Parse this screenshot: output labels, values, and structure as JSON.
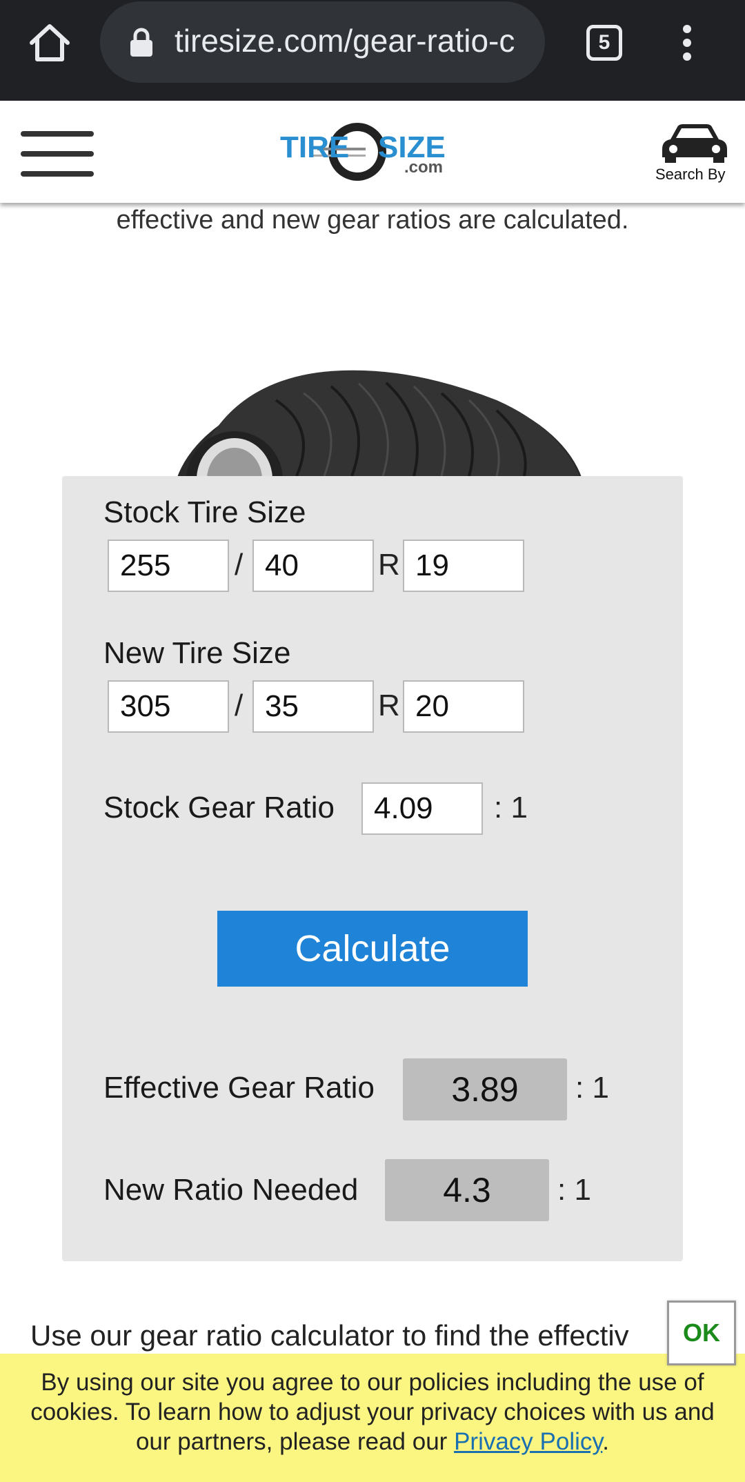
{
  "browser": {
    "url": "tiresize.com/gear-ratio-c",
    "tab_count": "5"
  },
  "header": {
    "logo_text": "TIRESIZE",
    "logo_sub": ".com",
    "search_by_label": "Search By"
  },
  "intro_text": "effective and new gear ratios are calculated.",
  "calculator": {
    "stock_label": "Stock Tire Size",
    "stock_width": "255",
    "stock_aspect": "40",
    "stock_rim": "19",
    "new_label": "New Tire Size",
    "new_width": "305",
    "new_aspect": "35",
    "new_rim": "20",
    "slash": "/",
    "rim_prefix": "R",
    "gear_label": "Stock Gear Ratio",
    "gear_value": "4.09",
    "ratio_suffix": ": 1",
    "calculate_label": "Calculate",
    "effective_label": "Effective Gear Ratio",
    "effective_value": "3.89",
    "needed_label": "New Ratio Needed",
    "needed_value": "4.3"
  },
  "bottom_text": "Use our gear ratio calculator to find the effectiv",
  "cookie": {
    "text_1": "By using our site you agree to our policies including the use of",
    "text_2": "cookies. To learn how to adjust your privacy choices with us and",
    "text_3": "our partners, please read our ",
    "link": "Privacy Policy",
    "end": ".",
    "ok_label": "OK"
  }
}
